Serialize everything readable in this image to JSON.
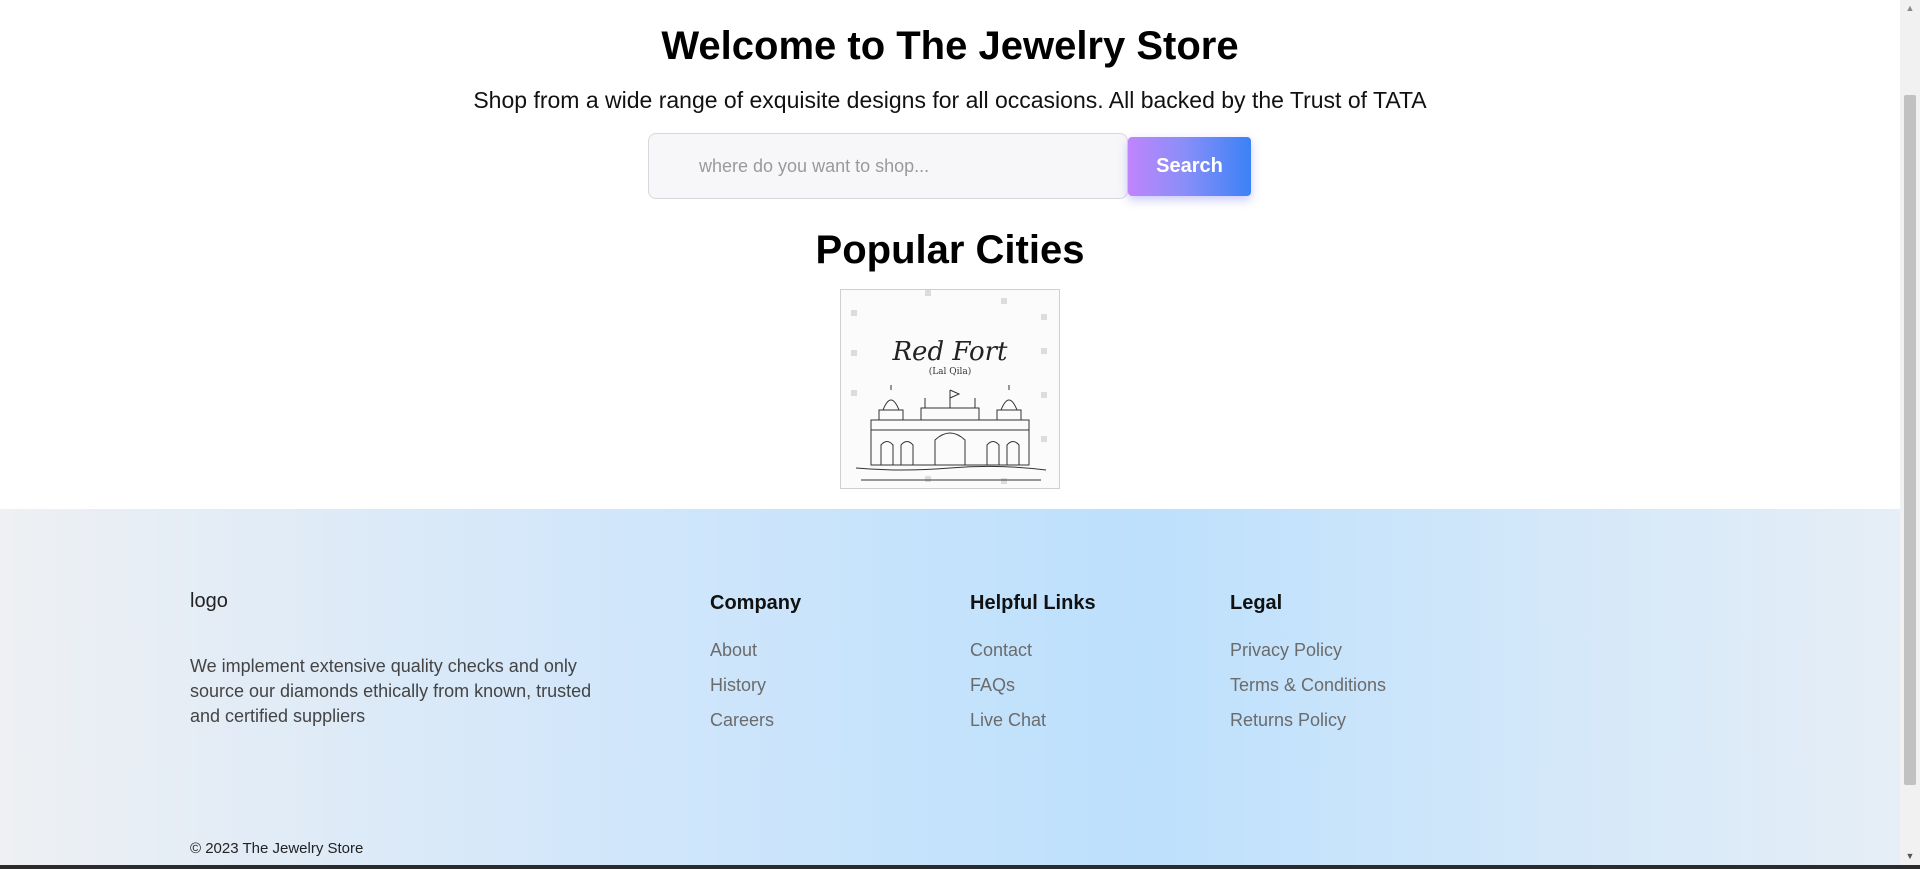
{
  "hero": {
    "title": "Welcome to The Jewelry Store",
    "subtitle": "Shop from a wide range of exquisite designs for all occasions. All backed by the Trust of TATA"
  },
  "search": {
    "placeholder": "where do you want to shop...",
    "value": "",
    "button_label": "Search"
  },
  "popular": {
    "title": "Popular Cities",
    "cities": [
      {
        "image_title": "Red Fort",
        "image_subtitle": "(Lal Qila)"
      }
    ]
  },
  "footer": {
    "logo_alt": "logo",
    "description": "We implement extensive quality checks and only source our diamonds ethically from known, trusted and certified suppliers",
    "columns": [
      {
        "heading": "Company",
        "links": [
          "About",
          "History",
          "Careers"
        ]
      },
      {
        "heading": "Helpful Links",
        "links": [
          "Contact",
          "FAQs",
          "Live Chat"
        ]
      },
      {
        "heading": "Legal",
        "links": [
          "Privacy Policy",
          "Terms & Conditions",
          "Returns Policy"
        ]
      }
    ],
    "copyright": "© 2023 The Jewelry Store"
  },
  "colors": {
    "search_gradient_start": "#c084fc",
    "search_gradient_end": "#3b82f6",
    "footer_bg": "#bde0fd"
  },
  "icons": {
    "scroll_up": "scroll-up-arrow-icon",
    "scroll_down": "scroll-down-arrow-icon"
  }
}
